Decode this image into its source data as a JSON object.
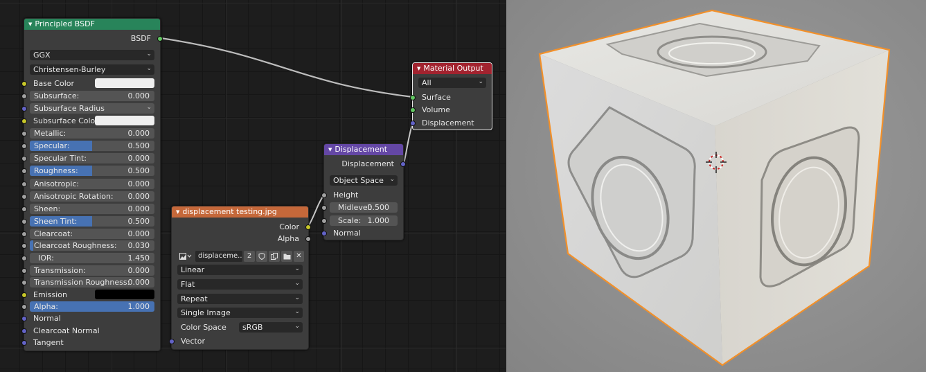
{
  "nodes": {
    "principled": {
      "title": "Principled BSDF",
      "output": "BSDF",
      "distribution": "GGX",
      "subsurface_method": "Christensen-Burley",
      "inputs": [
        {
          "label": "Base Color",
          "kind": "color",
          "color": "#efefef",
          "socket": "yellow"
        },
        {
          "label": "Subsurface:",
          "value": "0.000",
          "socket": "grey"
        },
        {
          "label": "Subsurface Radius",
          "kind": "dropdown",
          "socket": "blue"
        },
        {
          "label": "Subsurface Color",
          "kind": "color",
          "color": "#efefef",
          "socket": "yellow"
        },
        {
          "label": "Metallic:",
          "value": "0.000",
          "socket": "grey"
        },
        {
          "label": "Specular:",
          "value": "0.500",
          "fill": 0.5,
          "socket": "grey"
        },
        {
          "label": "Specular Tint:",
          "value": "0.000",
          "socket": "grey"
        },
        {
          "label": "Roughness:",
          "value": "0.500",
          "fill": 0.5,
          "socket": "grey"
        },
        {
          "label": "Anisotropic:",
          "value": "0.000",
          "socket": "grey"
        },
        {
          "label": "Anisotropic Rotation:",
          "value": "0.000",
          "socket": "grey"
        },
        {
          "label": "Sheen:",
          "value": "0.000",
          "socket": "grey"
        },
        {
          "label": "Sheen Tint:",
          "value": "0.500",
          "fill": 0.5,
          "socket": "grey"
        },
        {
          "label": "Clearcoat:",
          "value": "0.000",
          "socket": "grey"
        },
        {
          "label": "Clearcoat Roughness:",
          "value": "0.030",
          "fill": 0.03,
          "socket": "grey"
        },
        {
          "label": "IOR:",
          "value": "1.450",
          "socket": "grey",
          "center": true
        },
        {
          "label": "Transmission:",
          "value": "0.000",
          "socket": "grey"
        },
        {
          "label": "Transmission Roughness:",
          "value": "0.000",
          "socket": "grey"
        },
        {
          "label": "Emission",
          "kind": "color",
          "color": "#000000",
          "socket": "yellow"
        },
        {
          "label": "Alpha:",
          "value": "1.000",
          "fill": 1.0,
          "socket": "grey"
        },
        {
          "label": "Normal",
          "kind": "plain",
          "socket": "blue"
        },
        {
          "label": "Clearcoat Normal",
          "kind": "plain",
          "socket": "blue"
        },
        {
          "label": "Tangent",
          "kind": "plain",
          "socket": "blue"
        }
      ]
    },
    "image": {
      "title": "displacement testing.jpg",
      "out_color": "Color",
      "out_alpha": "Alpha",
      "image_name": "displaceme..",
      "users": "2",
      "interpolation": "Linear",
      "projection": "Flat",
      "extension": "Repeat",
      "source": "Single Image",
      "color_space_label": "Color Space",
      "color_space": "sRGB",
      "in_vector": "Vector"
    },
    "displacement": {
      "title": "Displacement",
      "output": "Displacement",
      "space": "Object Space",
      "in_height": "Height",
      "midlevel_label": "Midlevel:",
      "midlevel": "0.500",
      "scale_label": "Scale:",
      "scale": "1.000",
      "in_normal": "Normal"
    },
    "output": {
      "title": "Material Output",
      "target": "All",
      "in_surface": "Surface",
      "in_volume": "Volume",
      "in_displacement": "Displacement"
    }
  },
  "colors": {
    "shader_header": "#28845a",
    "texture_header": "#c5683a",
    "vector_header": "#6447a5",
    "output_header": "#a2232f",
    "slider_fill": "#4772b3",
    "selection_outline": "#f2902a"
  }
}
